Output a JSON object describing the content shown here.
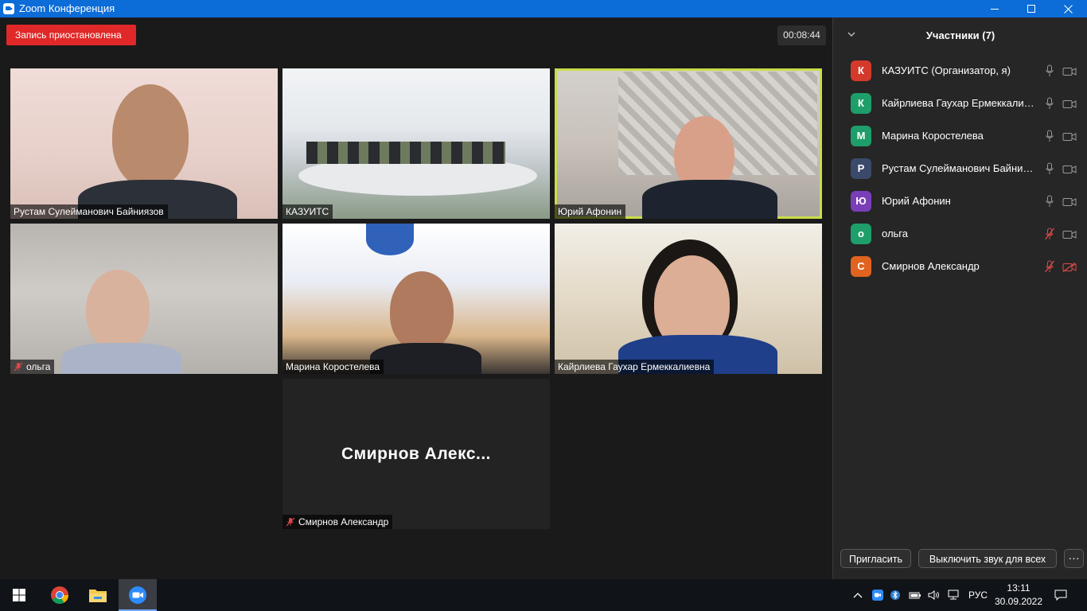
{
  "window": {
    "title": "Zoom Конференция"
  },
  "recording": {
    "status": "Запись приостановлена"
  },
  "meeting": {
    "timer": "00:08:44"
  },
  "video_tiles": [
    {
      "name": "Рустам Сулейманович Байниязов",
      "muted": false,
      "active": false
    },
    {
      "name": "КАЗУИТС",
      "muted": false,
      "active": false
    },
    {
      "name": "Юрий Афонин",
      "muted": false,
      "active": true
    },
    {
      "name": "ольга",
      "muted": true,
      "active": false
    },
    {
      "name": "Марина Коростелева",
      "muted": false,
      "active": false
    },
    {
      "name": "Кайрлиева Гаухар Ермеккалиевна",
      "muted": false,
      "active": false
    },
    {
      "name": "Смирнов Александр",
      "muted": true,
      "active": false,
      "display_name": "Смирнов  Алекс..."
    }
  ],
  "participants_panel": {
    "title": "Участники (7)",
    "participants": [
      {
        "initial": "К",
        "name": "КАЗУИТС (Организатор, я)",
        "avatar_color": "#d43a2c",
        "mic_muted": false,
        "video_off": false
      },
      {
        "initial": "К",
        "name": "Кайрлиева Гаухар Ермеккалиевна",
        "avatar_color": "#1e9e6a",
        "mic_muted": false,
        "video_off": false
      },
      {
        "initial": "М",
        "name": "Марина Коростелева",
        "avatar_color": "#1e9e6a",
        "mic_muted": false,
        "video_off": false
      },
      {
        "initial": "Р",
        "name": "Рустам Сулейманович Байниязов",
        "avatar_color": "#3b4a6b",
        "mic_muted": false,
        "video_off": false
      },
      {
        "initial": "Ю",
        "name": "Юрий Афонин",
        "avatar_color": "#7a3fb8",
        "mic_muted": false,
        "video_off": false
      },
      {
        "initial": "о",
        "name": "ольга",
        "avatar_color": "#1e9e6a",
        "mic_muted": true,
        "video_off": false
      },
      {
        "initial": "С",
        "name": "Смирнов Александр",
        "avatar_color": "#e0641f",
        "mic_muted": true,
        "video_off": true
      }
    ],
    "invite_label": "Пригласить",
    "mute_all_label": "Выключить звук для всех",
    "more_label": "···"
  },
  "taskbar": {
    "language": "РУС",
    "time": "13:11",
    "date": "30.09.2022"
  },
  "colors": {
    "titlebar": "#0c6cd8",
    "recording_badge": "#e02828",
    "active_speaker_border": "#c9dd4a",
    "muted_icon": "#e04848"
  }
}
